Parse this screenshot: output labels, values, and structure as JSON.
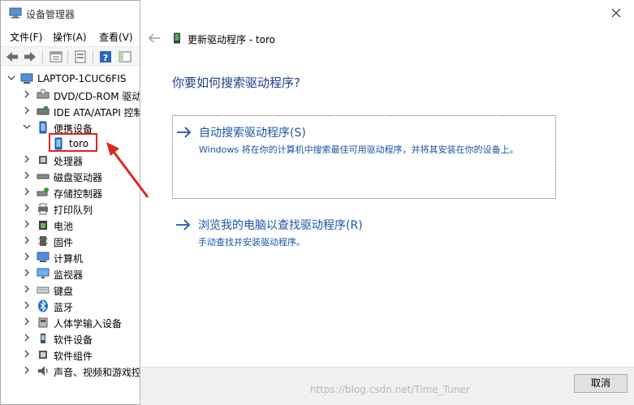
{
  "device_manager": {
    "title": "设备管理器",
    "menu": [
      "文件(F)",
      "操作(A)",
      "查看(V)"
    ],
    "toolbar_icons": [
      "back-icon",
      "forward-icon",
      "properties-icon",
      "console-tree-icon",
      "help-icon",
      "show-hide-icon"
    ],
    "tree": {
      "root": "LAPTOP-1CUC6FIS",
      "items": [
        {
          "label": "DVD/CD-ROM 驱动",
          "icon": "dvd-drive-icon",
          "expanded": false
        },
        {
          "label": "IDE ATA/ATAPI 控制",
          "icon": "ide-controller-icon",
          "expanded": false
        },
        {
          "label": "便携设备",
          "icon": "portable-device-icon",
          "expanded": true
        },
        {
          "label": "toro",
          "icon": "phone-icon",
          "child": true
        },
        {
          "label": "处理器",
          "icon": "processor-icon",
          "expanded": false
        },
        {
          "label": "磁盘驱动器",
          "icon": "disk-drive-icon",
          "expanded": false
        },
        {
          "label": "存储控制器",
          "icon": "storage-controller-icon",
          "expanded": false
        },
        {
          "label": "打印队列",
          "icon": "print-queue-icon",
          "expanded": false
        },
        {
          "label": "电池",
          "icon": "battery-icon",
          "expanded": false
        },
        {
          "label": "固件",
          "icon": "firmware-icon",
          "expanded": false
        },
        {
          "label": "计算机",
          "icon": "computer-icon",
          "expanded": false
        },
        {
          "label": "监视器",
          "icon": "monitor-icon",
          "expanded": false
        },
        {
          "label": "键盘",
          "icon": "keyboard-icon",
          "expanded": false
        },
        {
          "label": "蓝牙",
          "icon": "bluetooth-icon",
          "expanded": false
        },
        {
          "label": "人体学输入设备",
          "icon": "hid-icon",
          "expanded": false
        },
        {
          "label": "软件设备",
          "icon": "software-device-icon",
          "expanded": false
        },
        {
          "label": "软件组件",
          "icon": "software-component-icon",
          "expanded": false
        },
        {
          "label": "声音、视频和游戏控",
          "icon": "sound-icon",
          "expanded": false
        }
      ]
    }
  },
  "wizard": {
    "title": "更新驱动程序 - toro",
    "question": "你要如何搜索驱动程序?",
    "option_auto": {
      "title": "自动搜索驱动程序(S)",
      "description": "Windows 将在你的计算机中搜索最佳可用驱动程序，并将其安装在你的设备上。"
    },
    "option_browse": {
      "title": "浏览我的电脑以查找驱动程序(R)",
      "description": "手动查找并安装驱动程序。"
    },
    "cancel_label": "取消",
    "watermark": "https://blog.csdn.net/Time_Tuner"
  },
  "colors": {
    "accent": "#1a55a8",
    "question": "#1e3e8c",
    "highlight_box": "#e0241f"
  }
}
